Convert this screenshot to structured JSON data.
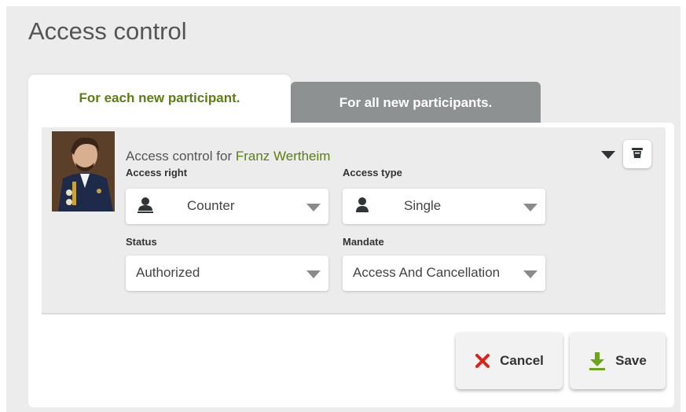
{
  "page": {
    "title": "Access control"
  },
  "tabs": [
    {
      "label": "For each new participant."
    },
    {
      "label": "For all new participants."
    }
  ],
  "card": {
    "heading_prefix": "Access control for ",
    "participant_name": "Franz Wertheim"
  },
  "fields": {
    "access_right": {
      "label": "Access right",
      "value": "Counter",
      "icon": "user-card-icon"
    },
    "access_type": {
      "label": "Access type",
      "value": "Single",
      "icon": "user-icon"
    },
    "status": {
      "label": "Status",
      "value": "Authorized"
    },
    "mandate": {
      "label": "Mandate",
      "value": "Access And Cancellation"
    }
  },
  "actions": {
    "cancel_label": "Cancel",
    "save_label": "Save"
  },
  "colors": {
    "accent_green": "#5b7f12",
    "cancel_red": "#d9241b",
    "save_green": "#6aa51a",
    "inactive_tab": "#8e9192"
  }
}
